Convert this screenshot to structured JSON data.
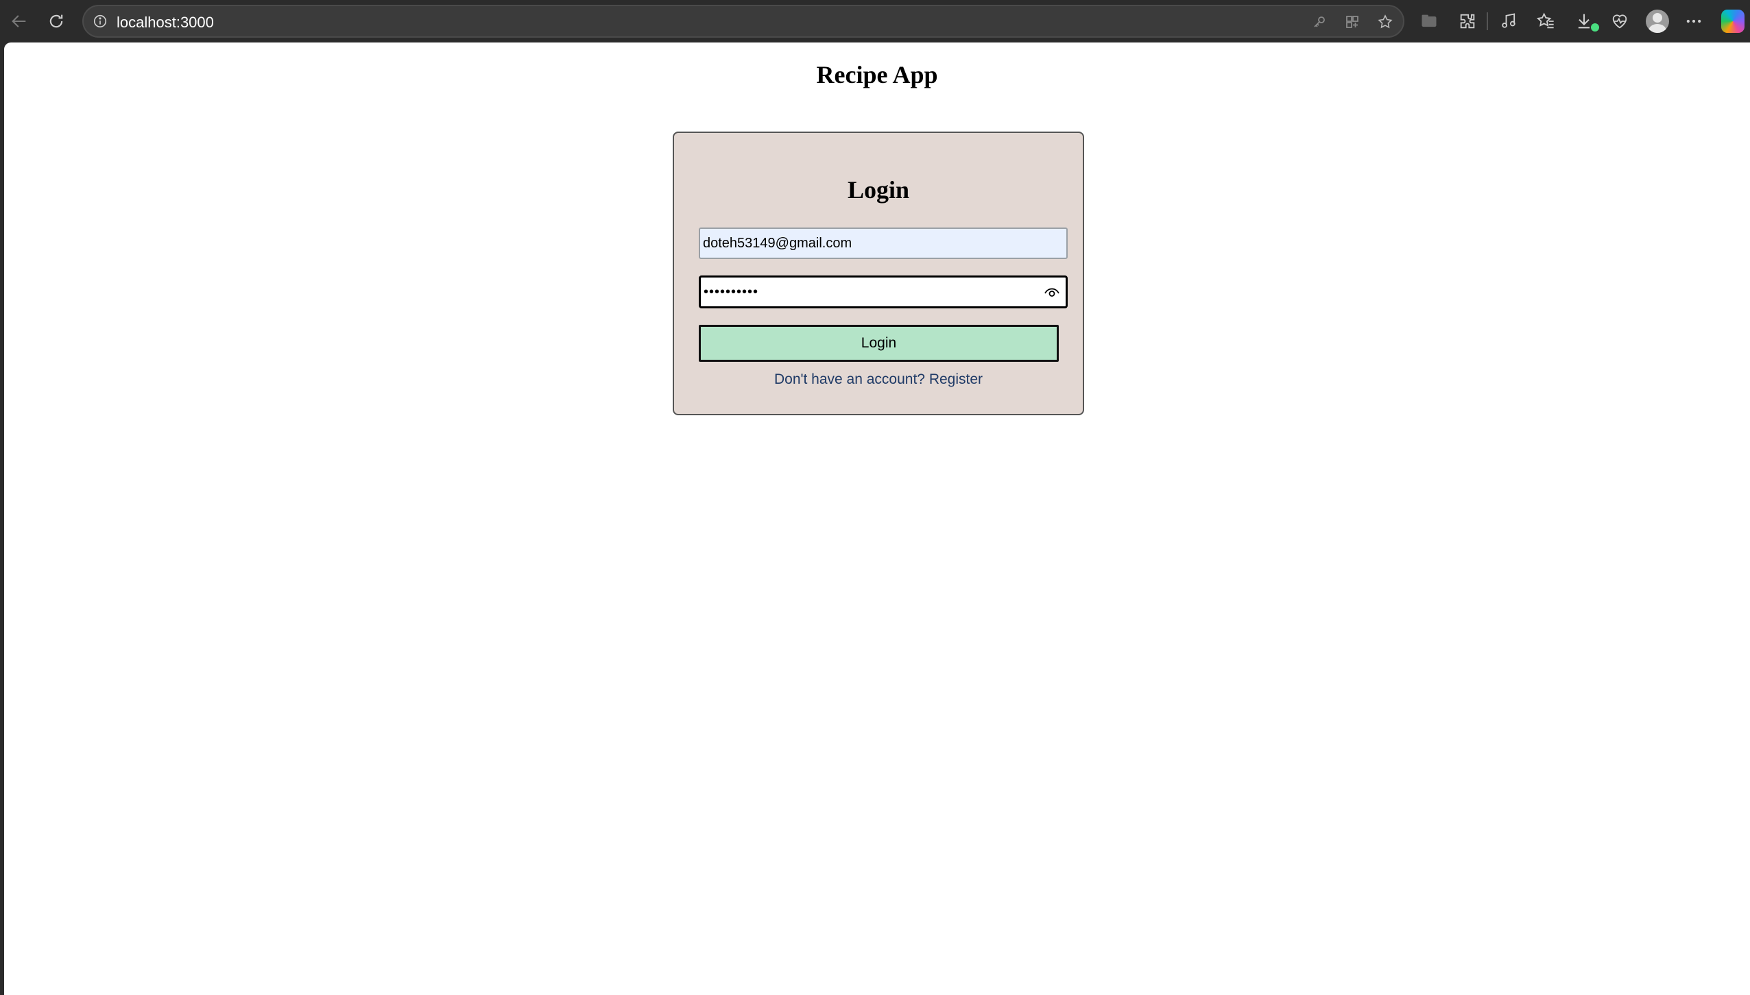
{
  "browser": {
    "url": "localhost:3000",
    "toolbar_icons": [
      "back-icon",
      "refresh-icon",
      "info-icon",
      "key-icon",
      "app-icon",
      "star-icon",
      "collections-icon",
      "extensions-icon",
      "media-icon",
      "favorites-icon",
      "downloads-icon",
      "health-icon",
      "profile-icon",
      "more-icon",
      "copilot-icon"
    ]
  },
  "page": {
    "title": "Recipe App"
  },
  "login": {
    "heading": "Login",
    "email_value": "doteh53149@gmail.com",
    "password_value": "••••••••••",
    "submit_label": "Login",
    "register_prompt": "Don't have an account? Register"
  },
  "colors": {
    "card_bg": "#e3d8d3",
    "button_bg": "#b4e4c8",
    "autofill_bg": "#e8f0fe",
    "link_color": "#1f3a66"
  }
}
